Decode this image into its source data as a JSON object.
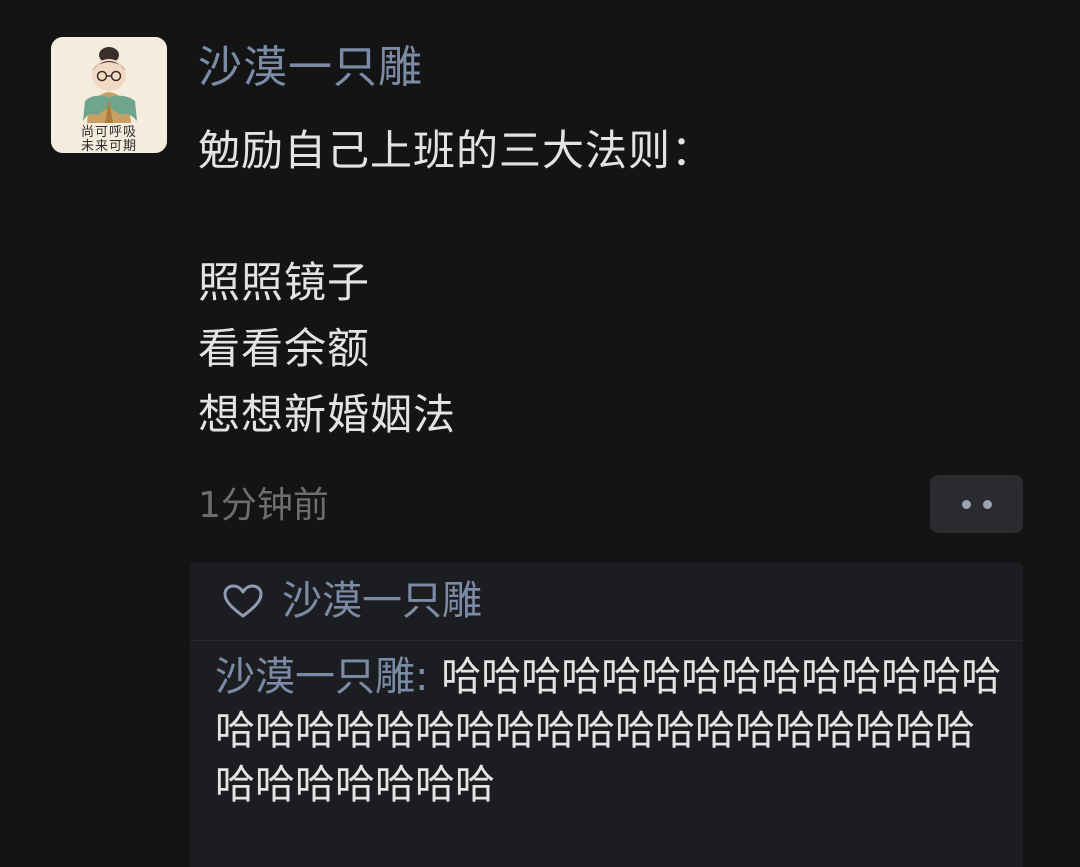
{
  "post": {
    "avatar": {
      "caption_line1": "尚可呼吸",
      "caption_line2": "未来可期"
    },
    "username": "沙漠一只雕",
    "content": {
      "title": "勉励自己上班的三大法则：",
      "lines": [
        "照照镜子",
        "看看余额",
        "想想新婚姻法"
      ]
    },
    "timestamp": "1分钟前",
    "more_button_icon": "more-dots-icon"
  },
  "comments": {
    "like_icon": "heart-icon",
    "liked_by": "沙漠一只雕",
    "items": [
      {
        "author": "沙漠一只雕",
        "separator": ": ",
        "text": "哈哈哈哈哈哈哈哈哈哈哈哈哈哈哈哈哈哈哈哈哈哈哈哈哈哈哈哈哈哈哈哈哈哈哈哈哈哈哈哈"
      }
    ]
  },
  "colors": {
    "background": "#141414",
    "username": "#7b8ba6",
    "text": "#e3e3e3",
    "muted": "#6d6d6d",
    "panel": "#1c1d20"
  }
}
